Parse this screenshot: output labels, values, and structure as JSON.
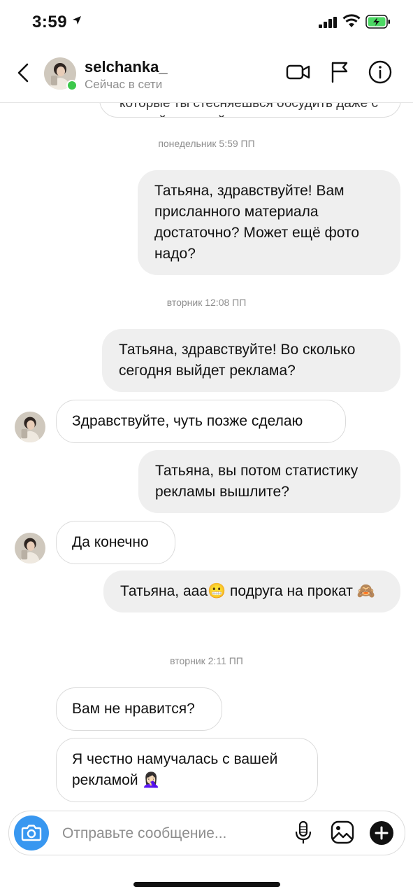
{
  "status_bar": {
    "time": "3:59",
    "battery_color": "#4cd964"
  },
  "header": {
    "username": "selchanka_",
    "status": "Сейчас в сети",
    "icons": [
      "back-chevron-icon",
      "video-call-icon",
      "flag-icon",
      "info-icon"
    ]
  },
  "previous_message_fragment": "которые ты стесняешься обсудить даже с лучшей подругой",
  "messages": [
    {
      "type": "timestamp",
      "text": "понедельник 5:59 ПП"
    },
    {
      "type": "outgoing",
      "text": "Татьяна, здравствуйте! Вам присланного материала достаточно? Может ещё фото надо?"
    },
    {
      "type": "timestamp",
      "text": "вторник 12:08 ПП"
    },
    {
      "type": "outgoing",
      "text": "Татьяна, здравствуйте! Во сколько сегодня выйдет реклама?"
    },
    {
      "type": "incoming",
      "text": "Здравствуйте, чуть позже сделаю"
    },
    {
      "type": "outgoing",
      "text": "Татьяна, вы потом статистику рекламы вышлите?"
    },
    {
      "type": "incoming",
      "text": "Да конечно"
    },
    {
      "type": "outgoing",
      "text": "Татьяна, ааа😬 подруга на прокат 🙈"
    },
    {
      "type": "timestamp",
      "text": "вторник 2:11 ПП"
    },
    {
      "type": "incoming",
      "text": "Вам не нравится?"
    },
    {
      "type": "incoming",
      "text": "Я честно намучалась с вашей рекламой 🤦🏻‍♀️"
    }
  ],
  "composer": {
    "placeholder": "Отправьте сообщение...",
    "icons": [
      "camera-icon",
      "microphone-icon",
      "gallery-icon",
      "plus-icon"
    ],
    "accent_color": "#3897f0"
  }
}
